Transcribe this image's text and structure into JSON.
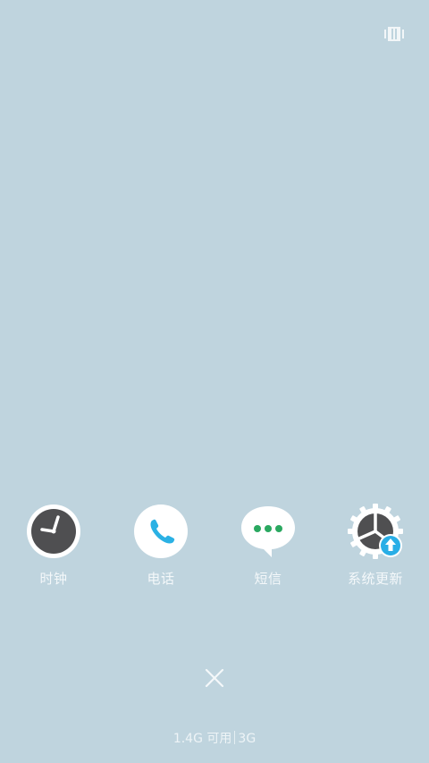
{
  "apps": [
    {
      "label": "时钟",
      "icon": "clock-icon"
    },
    {
      "label": "电话",
      "icon": "phone-icon"
    },
    {
      "label": "短信",
      "icon": "messages-icon"
    },
    {
      "label": "系统更新",
      "icon": "system-update-icon"
    }
  ],
  "memory": {
    "available": "1.4G 可用",
    "total": "3G"
  },
  "colors": {
    "background": "#bfd4de",
    "phone_blue": "#2bb1e4",
    "message_green": "#2aa860",
    "update_blue": "#29aee6",
    "clock_face": "#4f4f51"
  }
}
